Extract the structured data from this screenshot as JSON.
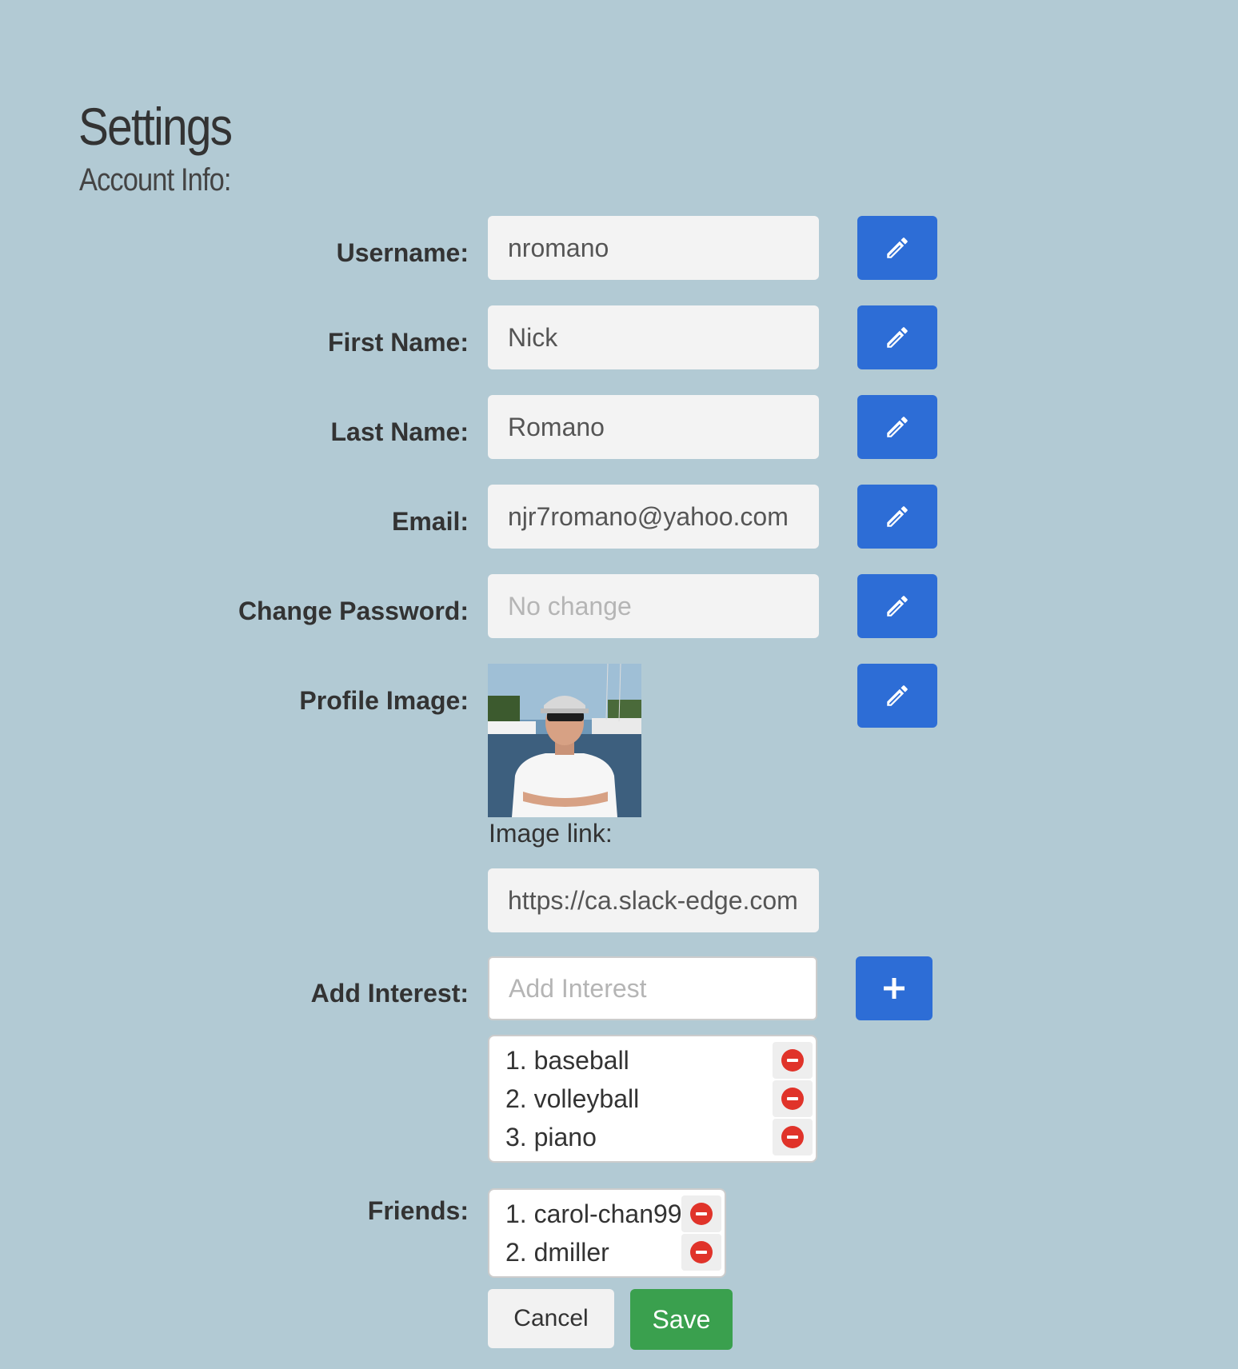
{
  "page": {
    "title": "Settings",
    "subtitle": "Account Info:"
  },
  "fields": {
    "username": {
      "label": "Username:",
      "value": "nromano"
    },
    "first_name": {
      "label": "First Name:",
      "value": "Nick"
    },
    "last_name": {
      "label": "Last Name:",
      "value": "Romano"
    },
    "email": {
      "label": "Email:",
      "value": "njr7romano@yahoo.com"
    },
    "password": {
      "label": "Change Password:",
      "placeholder": "No change"
    }
  },
  "profile": {
    "label": "Profile Image:",
    "image_link_label": "Image link:",
    "image_link_value": "https://ca.slack-edge.com"
  },
  "interests": {
    "label": "Add Interest:",
    "placeholder": "Add Interest",
    "items": [
      "1. baseball",
      "2. volleyball",
      "3. piano"
    ]
  },
  "friends": {
    "label": "Friends:",
    "items": [
      "1. carol-chan99",
      "2. dmiller"
    ]
  },
  "actions": {
    "cancel_label": "Cancel",
    "save_label": "Save"
  },
  "icons": {
    "edit": "pencil-icon",
    "add": "plus-icon",
    "remove": "minus-circle-icon"
  },
  "colors": {
    "background": "#b2cad4",
    "primary": "#2d6dd6",
    "save": "#3aa04e",
    "remove": "#e0332a"
  }
}
